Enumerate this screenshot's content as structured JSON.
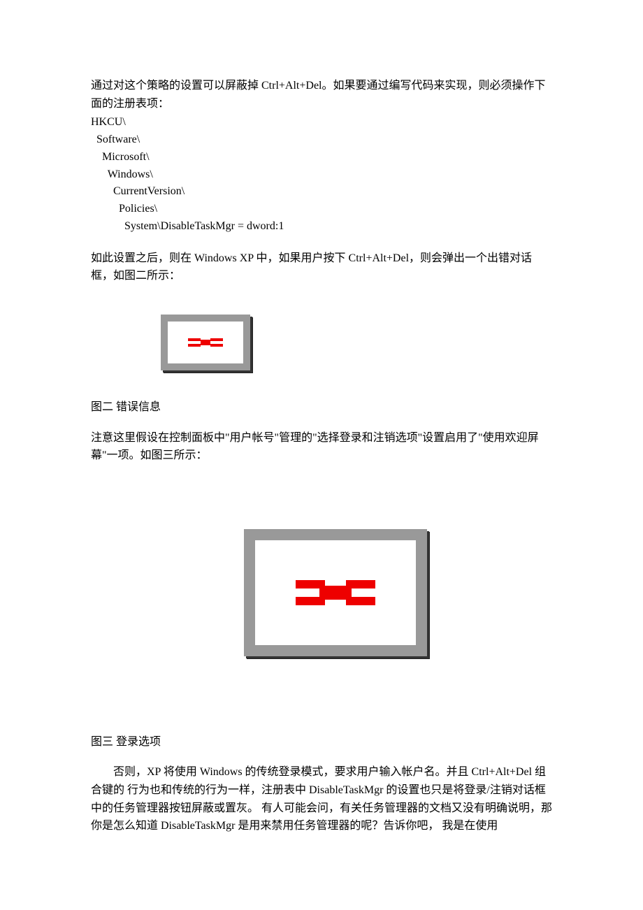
{
  "para1": "通过对这个策略的设置可以屏蔽掉 Ctrl+Alt+Del。如果要通过编写代码来实现，则必须操作下面的注册表项：",
  "registry": {
    "l1": "HKCU\\",
    "l2": "  Software\\",
    "l3": "    Microsoft\\",
    "l4": "      Windows\\",
    "l5": "        CurrentVersion\\",
    "l6": "          Policies\\",
    "l7": "            System\\DisableTaskMgr = dword:1"
  },
  "para2": "如此设置之后，则在 Windows XP 中，如果用户按下 Ctrl+Alt+Del，则会弹出一个出错对话框，如图二所示：",
  "caption2": "图二  错误信息",
  "para3": "注意这里假设在控制面板中\"用户帐号\"管理的\"选择登录和注销选项\"设置启用了\"使用欢迎屏幕\"一项。如图三所示：",
  "caption3": "图三  登录选项",
  "para4": "否则，XP 将使用 Windows 的传统登录模式，要求用户输入帐户名。并且 Ctrl+Alt+Del 组合键的 行为也和传统的行为一样，注册表中 DisableTaskMgr 的设置也只是将登录/注销对话框中的任务管理器按钮屏蔽或置灰。  有人可能会问，有关任务管理器的文档又没有明确说明，那你是怎么知道 DisableTaskMgr 是用来禁用任务管理器的呢？告诉你吧，  我是在使用"
}
